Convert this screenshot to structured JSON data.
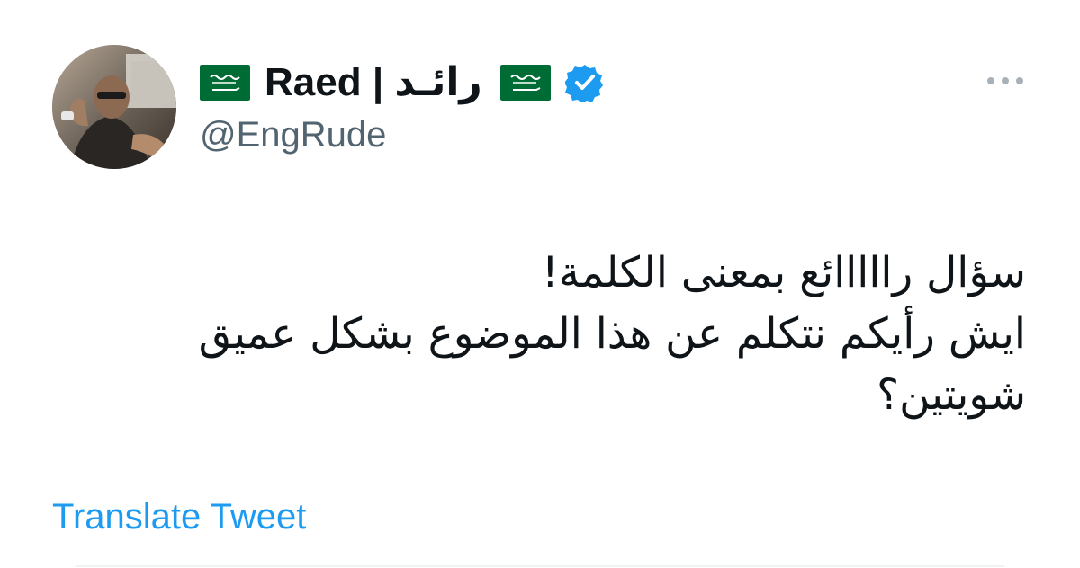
{
  "user": {
    "display_name": "Raed | رائـد",
    "handle": "@EngRude",
    "verified": true,
    "flag_icon": "saudi-flag-icon"
  },
  "tweet": {
    "lines": [
      "سؤال رااااائع بمعنى الكلمة!",
      "ايش رأيكم نتكلم عن هذا الموضوع بشكل عميق",
      "شويتين؟"
    ],
    "translate_label": "Translate Tweet"
  },
  "colors": {
    "verified_badge": "#1d9bf0",
    "link": "#1d9bf0",
    "handle": "#536471",
    "flag_green": "#006c35"
  }
}
